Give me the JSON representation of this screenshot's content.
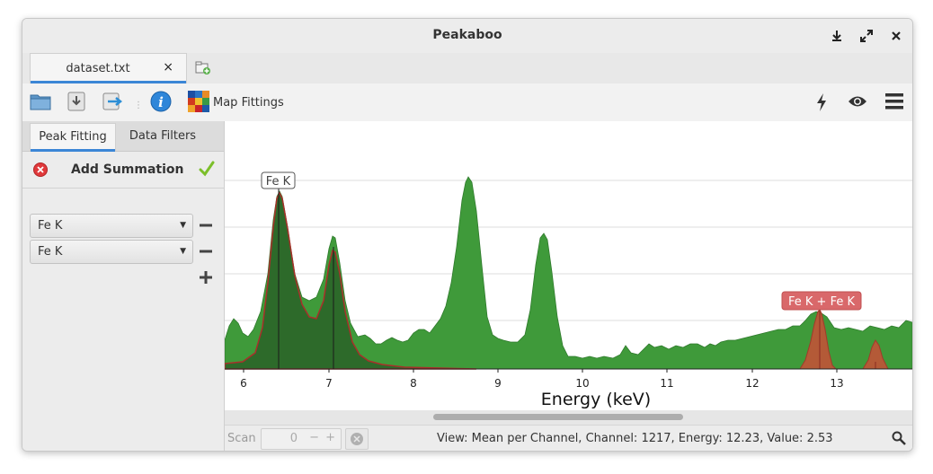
{
  "window": {
    "title": "Peakaboo"
  },
  "titlebar": {
    "buttons": [
      "download-icon",
      "fullscreen-icon",
      "close-icon"
    ]
  },
  "tabs": [
    {
      "label": "dataset.txt",
      "close": "×"
    }
  ],
  "toolbar": {
    "icons": [
      "open-folder-icon",
      "save-icon",
      "export-icon",
      "info-icon"
    ],
    "map_fittings_label": "Map Fittings",
    "right_icons": [
      "lightning-icon",
      "eye-icon",
      "menu-icon"
    ]
  },
  "left_panel": {
    "tabs": [
      "Peak Fitting",
      "Data Filters"
    ],
    "active_tab": "Peak Fitting",
    "summation": {
      "title": "Add Summation",
      "entries": [
        {
          "value": "Fe K"
        },
        {
          "value": "Fe K"
        }
      ]
    }
  },
  "plot": {
    "x_axis_label": "Energy (keV)",
    "x_ticks": [
      "6",
      "7",
      "8",
      "9",
      "10",
      "11",
      "12",
      "13"
    ],
    "annotations": [
      {
        "label": "Fe K"
      },
      {
        "label": "Fe K + Fe K"
      }
    ],
    "colors": {
      "spectrum_fill": "#3f9a3a",
      "fitted_fill": "#2d6a2a",
      "fit_line": "#a8302a",
      "summation_fill": "#b45a37",
      "summation_label_bg": "#d9686a",
      "gridline": "#dcdcdc"
    }
  },
  "status": {
    "scan_label": "Scan",
    "scan_value": "0",
    "scan_minus": "−",
    "scan_plus": "+",
    "info": "View: Mean per Channel,  Channel: 1217,  Energy: 12.23,  Value: 2.53"
  }
}
